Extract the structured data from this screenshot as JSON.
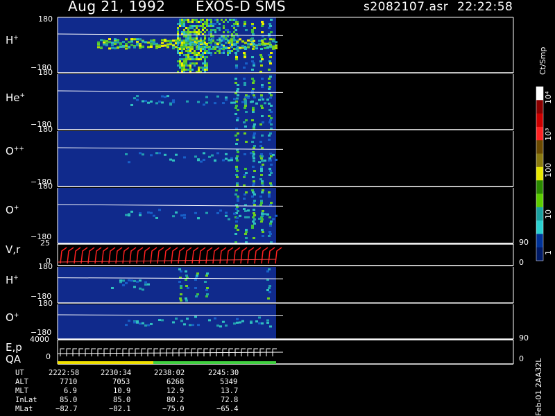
{
  "header": {
    "date": "Aug 21, 1992",
    "mission": "EXOS-D SMS",
    "file": "s2082107.asr",
    "time": "22:22:58"
  },
  "colorbar": {
    "unit": "Ct/Smp",
    "ticks": [
      "10⁴",
      "10³",
      "100",
      "10",
      "1"
    ],
    "colors": [
      "#ffffff",
      "#8b0000",
      "#cc0000",
      "#ff2222",
      "#6b4a00",
      "#8a7a10",
      "#e8e800",
      "#2a8a00",
      "#5ccc00",
      "#1aa0a0",
      "#2ad0d0",
      "#003399",
      "#001a66"
    ]
  },
  "panels": [
    {
      "id": "h1",
      "label_base": "H",
      "label_sup": "+",
      "ymax": "180",
      "ymin": "−180"
    },
    {
      "id": "he",
      "label_base": "He",
      "label_sup": "+",
      "ymax": "180",
      "ymin": "−180"
    },
    {
      "id": "opp",
      "label_base": "O",
      "label_sup": "++",
      "ymax": "180",
      "ymin": "−180"
    },
    {
      "id": "op",
      "label_base": "O",
      "label_sup": "+",
      "ymax": "180",
      "ymin": "−180"
    },
    {
      "id": "h2",
      "label_base": "H",
      "label_sup": "+",
      "ymax": "180",
      "ymin": "−180"
    },
    {
      "id": "o2",
      "label_base": "O",
      "label_sup": "+",
      "ymax": "180",
      "ymin": "−180"
    }
  ],
  "vr_panel": {
    "label": "V,r",
    "ymax": "25",
    "ymin": "0",
    "right_max": "90",
    "right_min": "0"
  },
  "ep_panel": {
    "label1": "E,p",
    "label2": "QA",
    "ymax": "4000",
    "ymin": "0",
    "right_max": "90",
    "right_min": "0"
  },
  "ephemeris": {
    "rows": [
      {
        "name": "UT",
        "values": [
          "2222:58",
          "2230:34",
          "2238:02",
          "2245:30"
        ]
      },
      {
        "name": "ALT",
        "values": [
          "7710",
          "7053",
          "6268",
          "5349"
        ]
      },
      {
        "name": "MLT",
        "values": [
          "6.9",
          "10.9",
          "12.9",
          "13.7"
        ]
      },
      {
        "name": "InLat",
        "values": [
          "85.0",
          "85.0",
          "80.2",
          "72.8"
        ]
      },
      {
        "name": "MLat",
        "values": [
          "−82.7",
          "−82.1",
          "−75.0",
          "−65.4"
        ]
      }
    ]
  },
  "footer_side": "Feb-01 2AA32L",
  "chart_data": {
    "type": "heatmap",
    "description_free": "",
    "panels": [
      "H+",
      "He+",
      "O++",
      "O+",
      "H+",
      "O+"
    ],
    "yrange": [
      -180,
      180
    ],
    "x_ticks": [
      "2222:58",
      "2230:34",
      "2238:02",
      "2245:30"
    ],
    "colorscale_ct_per_smp": [
      "1",
      "10",
      "100",
      "10³",
      "10⁴"
    ]
  }
}
